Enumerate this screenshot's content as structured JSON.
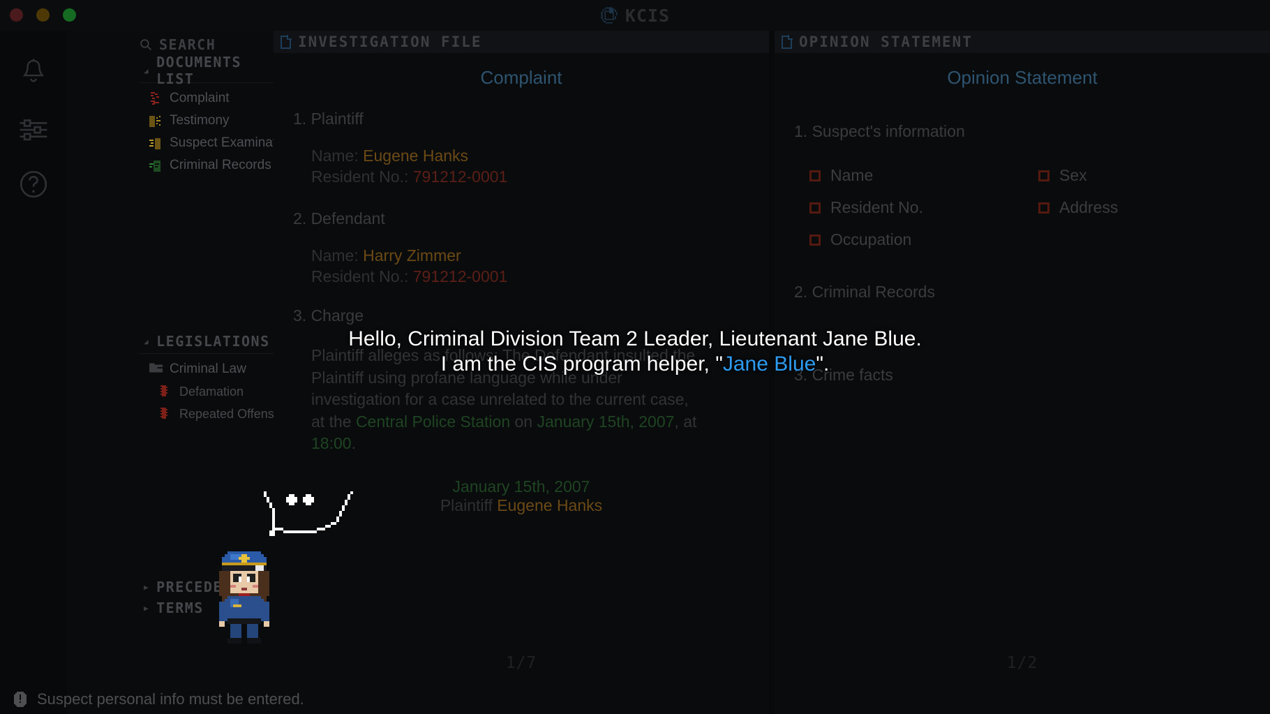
{
  "window": {
    "title": "KCIS",
    "logo_icon": "refresh-circle-icon",
    "traffic_lights": [
      "close-button",
      "minimize-button",
      "maximize-button"
    ]
  },
  "colors": {
    "background": "#08090b",
    "panel": "#0a0b0d",
    "pane_header": "#101216",
    "accent_blue": "#2d9cf0",
    "doc_title_blue": "#2e5470",
    "name_amber": "#6b4a16",
    "resident_red": "#5b1f17",
    "green_highlight": "#1e4422",
    "checkbox_red": "#54190f",
    "text_dim": "#3c3d3f"
  },
  "rail": {
    "items": [
      {
        "name": "notifications-bell",
        "icon": "bell-icon"
      },
      {
        "name": "settings-sliders",
        "icon": "sliders-icon"
      },
      {
        "name": "help",
        "icon": "question-circle-icon"
      }
    ]
  },
  "sidebar": {
    "search": {
      "label": "SEARCH",
      "icon": "search-icon"
    },
    "documents_group": {
      "label": "DOCUMENTS LIST",
      "collapse_icon": "triangle-collapse-icon",
      "items": [
        {
          "label": "Complaint",
          "icon": "complaint-doc-icon"
        },
        {
          "label": "Testimony",
          "icon": "testimony-doc-icon"
        },
        {
          "label": "Suspect Examination",
          "icon": "suspect-exam-doc-icon"
        },
        {
          "label": "Criminal Records",
          "icon": "criminal-records-doc-icon"
        }
      ]
    },
    "legislations_group": {
      "label": "LEGISLATIONS",
      "collapse_icon": "triangle-collapse-icon",
      "folder": {
        "label": "Criminal Law",
        "icon": "folder-icon"
      },
      "items": [
        {
          "label": "Defamation",
          "icon": "law-article-icon"
        },
        {
          "label": "Repeated Offense",
          "icon": "law-article-icon"
        }
      ]
    },
    "precedents_group": {
      "label": "PRECEDENTS",
      "expand_icon": "triangle-expand-icon"
    },
    "terms_group": {
      "label": "TERMS",
      "expand_icon": "triangle-expand-icon"
    }
  },
  "center_pane": {
    "header": {
      "title": "INVESTIGATION FILE",
      "icon": "file-icon"
    },
    "document": {
      "title": "Complaint",
      "sections": [
        {
          "heading": "1. Plaintiff",
          "fields": [
            {
              "label": "Name:",
              "value": "Eugene Hanks",
              "value_kind": "name"
            },
            {
              "label": "Resident No.:",
              "value": "791212-0001",
              "value_kind": "resident"
            }
          ]
        },
        {
          "heading": "2. Defendant",
          "fields": [
            {
              "label": "Name:",
              "value": "Harry Zimmer",
              "value_kind": "name"
            },
            {
              "label": "Resident No.:",
              "value": "791212-0001",
              "value_kind": "resident"
            }
          ]
        },
        {
          "heading": "3. Charge"
        }
      ],
      "charge_paragraph": {
        "t1": "Plaintiff alleges as follows: The Defendant insulted the Plaintiff using profane language while under investigation for a case unrelated to the current case, at the ",
        "place": "Central Police Station",
        "t2": " on ",
        "date": "January 15th, 2007",
        "t3": ", at ",
        "time": "18:00",
        "t4": "."
      },
      "signature": {
        "date": "January 15th, 2007",
        "role": "Plaintiff",
        "name": "Eugene Hanks"
      },
      "page_indicator": "1/7"
    }
  },
  "right_pane": {
    "header": {
      "title": "OPINION STATEMENT",
      "icon": "file-icon"
    },
    "document": {
      "title": "Opinion Statement",
      "section1_heading": "1. Suspect's information",
      "checklist": [
        {
          "label": "Name",
          "checked": false
        },
        {
          "label": "Sex",
          "checked": false
        },
        {
          "label": "Resident No.",
          "checked": false
        },
        {
          "label": "Address",
          "checked": false
        },
        {
          "label": "Occupation",
          "checked": false
        }
      ],
      "section2_heading": "2. Criminal Records",
      "section3_heading": "3. Crime facts",
      "page_indicator": "1/2"
    }
  },
  "dialogue": {
    "line1": "Hello, Criminal Division Team 2 Leader, Lieutenant Jane Blue.",
    "line2_pre": "I am the CIS program helper, \"",
    "line2_name": "Jane Blue",
    "line2_post": "\".",
    "speaker_sprite": "police-officer-sprite",
    "bubble": "speech-bubble-smile"
  },
  "statusbar": {
    "icon": "warning-exclamation-icon",
    "message": "Suspect personal info must be entered."
  }
}
